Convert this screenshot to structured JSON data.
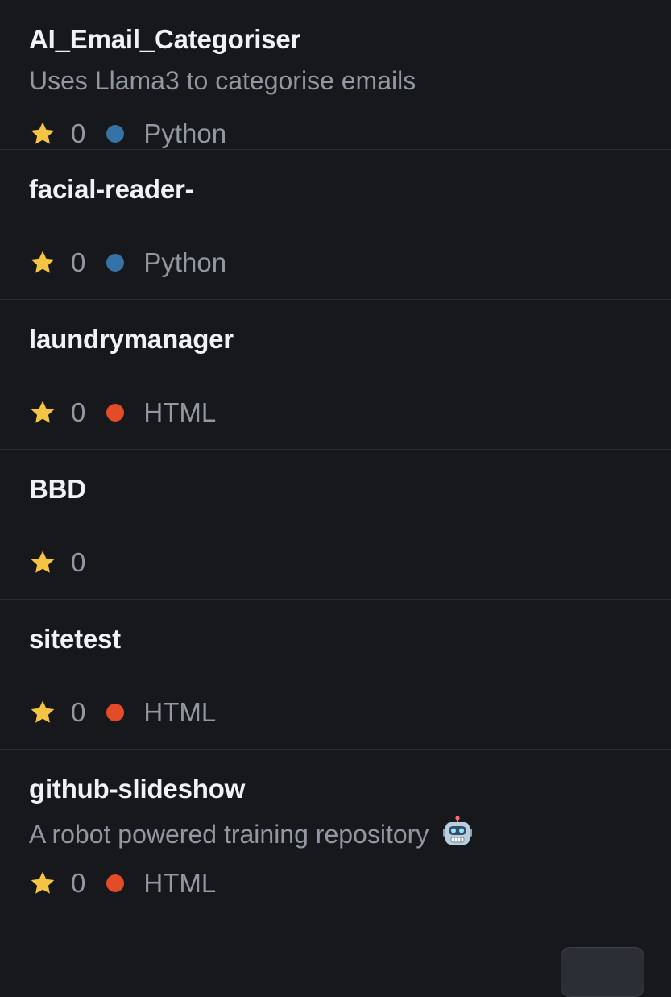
{
  "repos": [
    {
      "name": "AI_Email_Categoriser",
      "description": "Uses Llama3 to categorise emails",
      "stars": "0",
      "language": "Python",
      "language_color": "#3572A5"
    },
    {
      "name": "facial-reader-",
      "description": "",
      "stars": "0",
      "language": "Python",
      "language_color": "#3572A5"
    },
    {
      "name": "laundrymanager",
      "description": "",
      "stars": "0",
      "language": "HTML",
      "language_color": "#e34c26"
    },
    {
      "name": "BBD",
      "description": "",
      "stars": "0",
      "language": "",
      "language_color": ""
    },
    {
      "name": "sitetest",
      "description": "",
      "stars": "0",
      "language": "HTML",
      "language_color": "#e34c26"
    },
    {
      "name": "github-slideshow",
      "description": "A robot powered training repository",
      "description_icon": "robot-emoji-icon",
      "stars": "0",
      "language": "HTML",
      "language_color": "#e34c26"
    }
  ],
  "colors": {
    "background": "#17181c",
    "divider": "#2a2d33",
    "title": "#f0f3f6",
    "muted": "#9198a1",
    "star": "#f5c443"
  },
  "icons": {
    "star": "star-icon",
    "language": "language-color-dot"
  }
}
